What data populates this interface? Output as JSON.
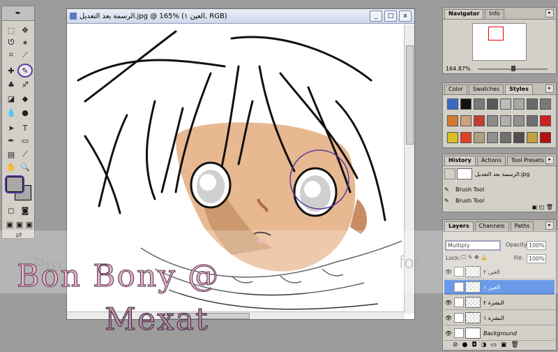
{
  "document": {
    "title": "الرسمة بعد التعديل.jpg @ 165% (العين ١, RGB)",
    "min": "_",
    "max": "□",
    "close": "x"
  },
  "navigator": {
    "tabs": [
      "Navigator",
      "Info"
    ],
    "zoom": "164.87%"
  },
  "styles": {
    "tabs": [
      "Color",
      "Swatches",
      "Styles"
    ],
    "swatch_colors": [
      [
        "#3a6ac8",
        "#111111",
        "#7a7a7a",
        "#5a5a5a",
        "#bcbcbc",
        "#a8a8a8",
        "#6a6a6a",
        "#7a7a7a"
      ],
      [
        "#d07a30",
        "#d0a080",
        "#c04030",
        "#8c8c8c",
        "#b0b0b0",
        "#909090",
        "#707070",
        "#d02020"
      ],
      [
        "#d8c020",
        "#e04020",
        "#b0a080",
        "#909090",
        "#707070",
        "#505050",
        "#c0a040",
        "#b01010"
      ]
    ]
  },
  "history": {
    "tabs": [
      "History",
      "Actions",
      "Tool Presets"
    ],
    "snapshot": "الرسمة بعد التعديل.jpg",
    "items": [
      "Brush Tool",
      "Brush Tool"
    ]
  },
  "layers": {
    "tabs": [
      "Layers",
      "Channels",
      "Paths"
    ],
    "blend_mode": "Multiply",
    "opacity_label": "Opacity:",
    "opacity": "100%",
    "lock_label": "Lock:",
    "fill_label": "Fill:",
    "fill": "100%",
    "rows": [
      {
        "name": "العين ٢",
        "selected": false,
        "visible": true
      },
      {
        "name": "العين ١",
        "selected": true,
        "visible": false
      },
      {
        "name": "البشرة ٢",
        "selected": false,
        "visible": true
      },
      {
        "name": "البشرة ١",
        "selected": false,
        "visible": true
      },
      {
        "name": "Background",
        "selected": false,
        "visible": true
      }
    ]
  },
  "watermark": {
    "line1": "Bon Bony @",
    "line2": "Mexat",
    "ghost_left": "Pro",
    "ghost_right": "for"
  },
  "colors": {
    "selection": "#3a7ae0",
    "annotation": "#5a3aa0",
    "skin": "#e8b890"
  }
}
